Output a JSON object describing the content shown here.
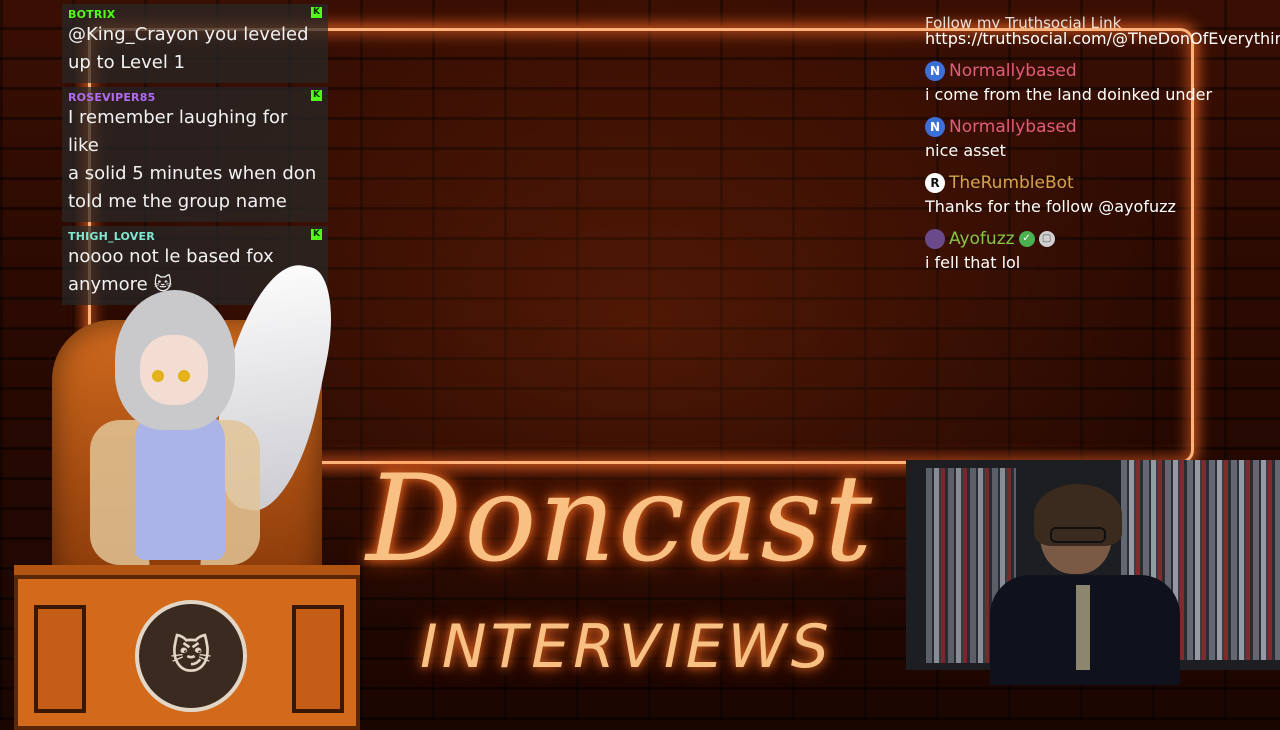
{
  "left_chat": [
    {
      "user": "BOTRIX",
      "user_color": "#53fc18",
      "text": "@King_Crayon you leveled up to Level 1",
      "lines": [
        "@King_Crayon you leveled",
        "up to Level 1"
      ]
    },
    {
      "user": "ROSEVIPER85",
      "user_color": "#b06cf0",
      "text": "I remember laughing for like a solid 5 minutes when don told me the group name",
      "lines": [
        "I remember laughing for like",
        "a solid 5 minutes when don",
        "told me the group name"
      ]
    },
    {
      "user": "THIGH_LOVER",
      "user_color": "#7fe8d0",
      "text": "noooo not le based fox anymore 🐱",
      "lines": [
        "noooo not le based fox",
        "anymore 🐱"
      ]
    }
  ],
  "right_chat": {
    "partial_top_line": "Follow my Truthsocial Link",
    "url_line": "https://truthsocial.com/@TheDonOfEverything",
    "messages": [
      {
        "avatar_letter": "N",
        "avatar_color": "#3d6fd9",
        "user": "Normallybased",
        "user_color": "#e05c7c",
        "text": "i come from the land doinked under"
      },
      {
        "avatar_letter": "N",
        "avatar_color": "#3d6fd9",
        "user": "Normallybased",
        "user_color": "#e05c7c",
        "text": "nice asset"
      },
      {
        "avatar_letter": "R",
        "avatar_color": "#ffffff",
        "user": "TheRumbleBot",
        "user_color": "#d4a34a",
        "text": "Thanks for the follow @ayofuzz"
      },
      {
        "avatar_letter": "",
        "avatar_color": "#6a4a8a",
        "user": "Ayofuzz",
        "user_color": "#85c742",
        "text": "i fell that lol",
        "badges": [
          "verified-badge-icon",
          "supporter-badge-icon"
        ]
      }
    ]
  },
  "logo": {
    "title": "Doncast",
    "subtitle": "INTERVIEWS"
  },
  "colors": {
    "accent": "#f9c083",
    "neon": "#ffb27a",
    "kick_green": "#53fc18"
  },
  "icons": [
    "kick-icon",
    "verified-badge-icon",
    "supporter-badge-icon",
    "cat-face-icon"
  ]
}
